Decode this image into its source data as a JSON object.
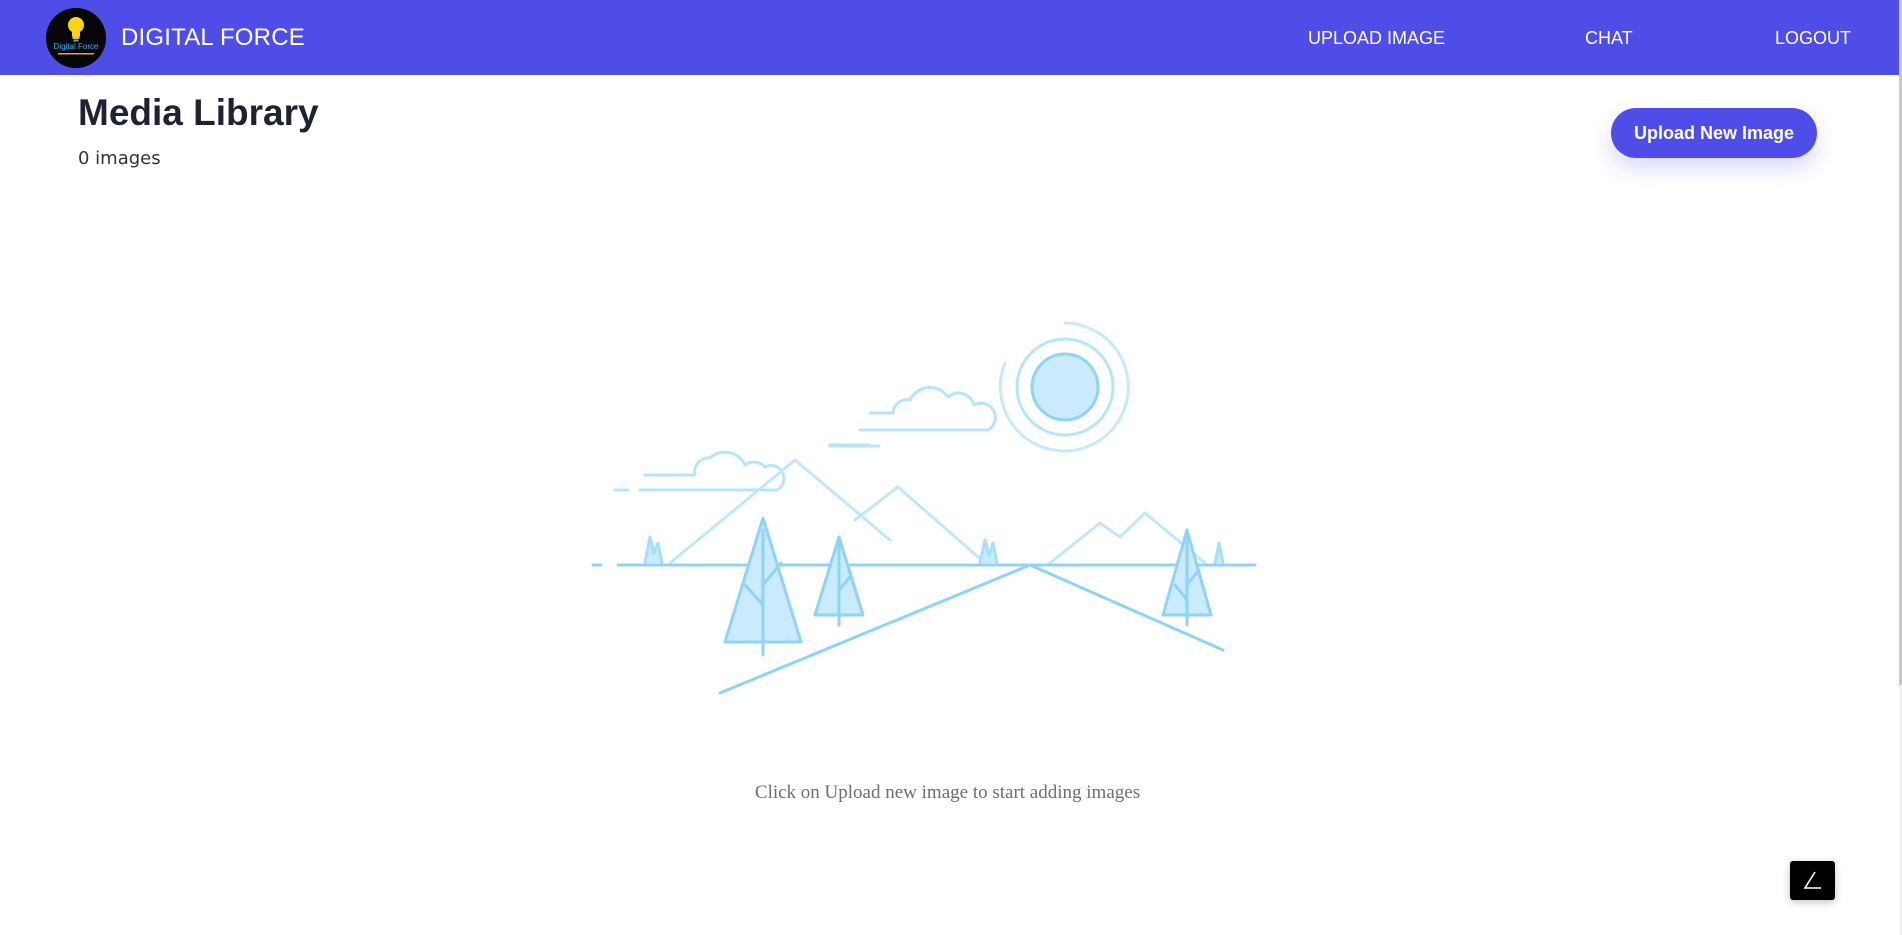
{
  "navbar": {
    "brand": "DIGITAL FORCE",
    "logo_text": "Digital Force",
    "links": [
      {
        "label": "UPLOAD IMAGE"
      },
      {
        "label": "CHAT"
      },
      {
        "label": "LOGOUT"
      }
    ],
    "background_color": "#4f4de7"
  },
  "main": {
    "title": "Media Library",
    "image_count": "0 images",
    "upload_button_label": "Upload New Image",
    "empty_message": "Click on Upload new image to start adding images"
  },
  "icons": {
    "logo": "lightbulb-logo-icon",
    "illustration": "empty-landscape-illustration",
    "corner_button": "angle-icon"
  },
  "colors": {
    "accent": "#4f4de7",
    "illustration": "#8fd3f7"
  }
}
